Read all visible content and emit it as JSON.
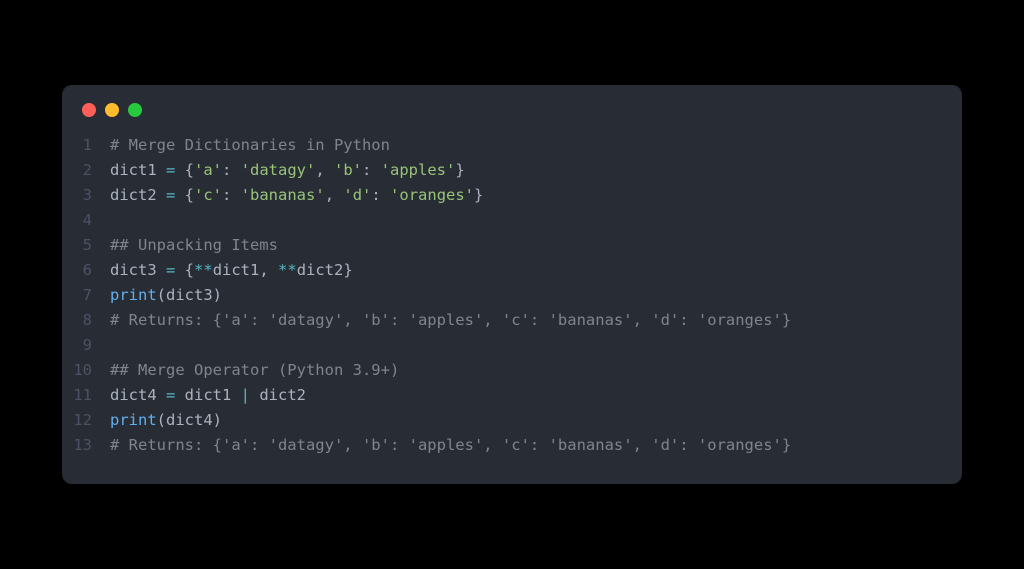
{
  "window": {
    "traffic_lights": [
      "close",
      "minimize",
      "maximize"
    ]
  },
  "colors": {
    "bg": "#282c34",
    "gutter": "#4b5263",
    "comment": "#7f848e",
    "variable": "#e5c07b",
    "operator": "#56b6c2",
    "default": "#abb2bf",
    "string": "#98c379",
    "function": "#61afef",
    "keyword_punct": "#c678dd"
  },
  "code": {
    "lines": [
      {
        "n": "1",
        "t": [
          {
            "c": "comment",
            "v": "# Merge Dictionaries in Python"
          }
        ]
      },
      {
        "n": "2",
        "t": [
          {
            "c": "default",
            "v": "dict1 "
          },
          {
            "c": "op",
            "v": "="
          },
          {
            "c": "default",
            "v": " {"
          },
          {
            "c": "string",
            "v": "'a'"
          },
          {
            "c": "default",
            "v": ": "
          },
          {
            "c": "string",
            "v": "'datagy'"
          },
          {
            "c": "default",
            "v": ", "
          },
          {
            "c": "string",
            "v": "'b'"
          },
          {
            "c": "default",
            "v": ": "
          },
          {
            "c": "string",
            "v": "'apples'"
          },
          {
            "c": "default",
            "v": "}"
          }
        ]
      },
      {
        "n": "3",
        "t": [
          {
            "c": "default",
            "v": "dict2 "
          },
          {
            "c": "op",
            "v": "="
          },
          {
            "c": "default",
            "v": " {"
          },
          {
            "c": "string",
            "v": "'c'"
          },
          {
            "c": "default",
            "v": ": "
          },
          {
            "c": "string",
            "v": "'bananas'"
          },
          {
            "c": "default",
            "v": ", "
          },
          {
            "c": "string",
            "v": "'d'"
          },
          {
            "c": "default",
            "v": ": "
          },
          {
            "c": "string",
            "v": "'oranges'"
          },
          {
            "c": "default",
            "v": "}"
          }
        ]
      },
      {
        "n": "4",
        "t": []
      },
      {
        "n": "5",
        "t": [
          {
            "c": "comment",
            "v": "## Unpacking Items"
          }
        ]
      },
      {
        "n": "6",
        "t": [
          {
            "c": "default",
            "v": "dict3 "
          },
          {
            "c": "op",
            "v": "="
          },
          {
            "c": "default",
            "v": " {"
          },
          {
            "c": "op",
            "v": "**"
          },
          {
            "c": "default",
            "v": "dict1, "
          },
          {
            "c": "op",
            "v": "**"
          },
          {
            "c": "default",
            "v": "dict2}"
          }
        ]
      },
      {
        "n": "7",
        "t": [
          {
            "c": "func",
            "v": "print"
          },
          {
            "c": "default",
            "v": "(dict3)"
          }
        ]
      },
      {
        "n": "8",
        "t": [
          {
            "c": "comment",
            "v": "# Returns: {'a': 'datagy', 'b': 'apples', 'c': 'bananas', 'd': 'oranges'}"
          }
        ]
      },
      {
        "n": "9",
        "t": []
      },
      {
        "n": "10",
        "t": [
          {
            "c": "comment",
            "v": "## Merge Operator (Python 3.9+)"
          }
        ]
      },
      {
        "n": "11",
        "t": [
          {
            "c": "default",
            "v": "dict4 "
          },
          {
            "c": "op",
            "v": "="
          },
          {
            "c": "default",
            "v": " dict1 "
          },
          {
            "c": "op",
            "v": "|"
          },
          {
            "c": "default",
            "v": " dict2"
          }
        ]
      },
      {
        "n": "12",
        "t": [
          {
            "c": "func",
            "v": "print"
          },
          {
            "c": "default",
            "v": "(dict4)"
          }
        ]
      },
      {
        "n": "13",
        "t": [
          {
            "c": "comment",
            "v": "# Returns: {'a': 'datagy', 'b': 'apples', 'c': 'bananas', 'd': 'oranges'}"
          }
        ]
      }
    ]
  }
}
